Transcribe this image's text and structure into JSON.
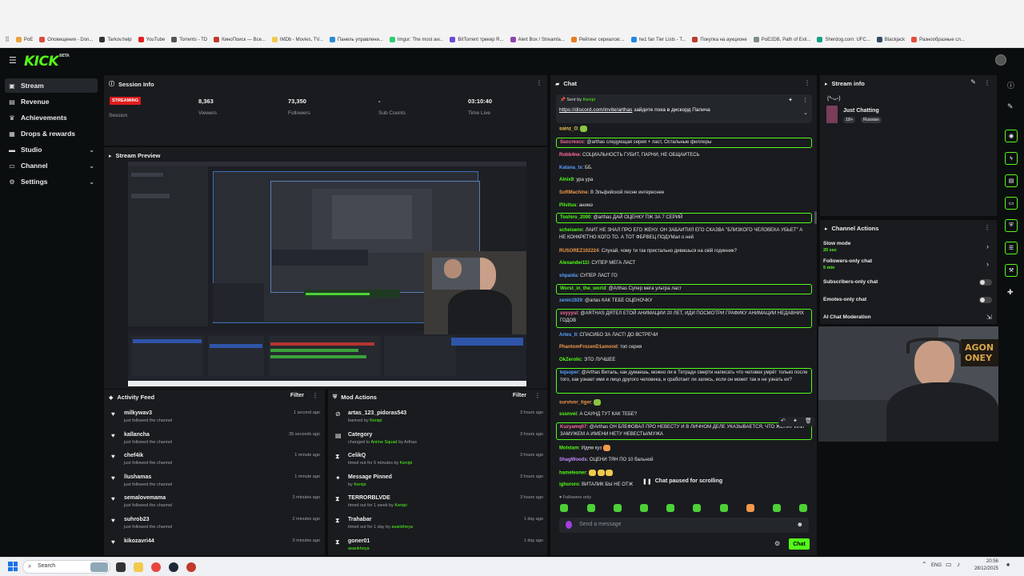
{
  "bookmarks": [
    "PoE",
    "Оповещения - Don...",
    "Tarkov.help",
    "YouTube",
    "Torrents - TD",
    "КиноПоиск — Все...",
    "IMDb - Movies, TV...",
    "Панель управлени...",
    "Imgur: The most aw...",
    "BitTorrent трекер R...",
    "Alert Box / Streamla...",
    "Рейтинг сериалов:...",
    "№1 fan Tier Lists - T...",
    "Покупка на аукционе",
    "PoE2DB, Path of Exil...",
    "Sherdog.com: UFC...",
    "Blackjack",
    "Разнообразные сл..."
  ],
  "header": {
    "logo": "KICK",
    "logo_sup": "BETA"
  },
  "nav": [
    {
      "label": "Stream",
      "icon": "stream-icon"
    },
    {
      "label": "Revenue",
      "icon": "revenue-icon"
    },
    {
      "label": "Achievements",
      "icon": "trophy-icon"
    },
    {
      "label": "Drops & rewards",
      "icon": "gift-icon"
    },
    {
      "label": "Studio",
      "icon": "studio-icon"
    },
    {
      "label": "Channel",
      "icon": "channel-icon"
    },
    {
      "label": "Settings",
      "icon": "gear-icon"
    }
  ],
  "session": {
    "title": "Session Info",
    "status": "STREAMING",
    "session_label": "Session",
    "viewers": "8,363",
    "viewers_label": "Viewers",
    "followers": "73,350",
    "followers_label": "Followers",
    "subs": "-",
    "subs_label": "Sub Counts",
    "time": "03:10:40",
    "time_label": "Time Live"
  },
  "preview": {
    "title": "Stream Preview"
  },
  "activity": {
    "title": "Activity Feed",
    "filter": "Filter",
    "items": [
      {
        "name": "milkywav3",
        "sub": "just followed the channel",
        "time": "1 second ago"
      },
      {
        "name": "kallancha",
        "sub": "just followed the channel",
        "time": "35 seconds ago"
      },
      {
        "name": "chef4ik",
        "sub": "just followed the channel",
        "time": "1 minute ago"
      },
      {
        "name": "llushamas",
        "sub": "just followed the channel",
        "time": "1 minute ago"
      },
      {
        "name": "semalovemama",
        "sub": "just followed the channel",
        "time": "2 minutes ago"
      },
      {
        "name": "suhrob23",
        "sub": "just followed the channel",
        "time": "2 minutes ago"
      },
      {
        "name": "kikozavri44",
        "sub": "",
        "time": "3 minutes ago"
      }
    ]
  },
  "mod": {
    "title": "Mod Actions",
    "filter": "Filter",
    "items": [
      {
        "name": "artas_123_pidoras543",
        "pre": "banned by",
        "by": "Kenipi",
        "post": "",
        "time": "3 hours ago"
      },
      {
        "name": "Category",
        "pre": "changed to",
        "by": "Anime Squad",
        "post": " by Arthas",
        "time": "3 hours ago"
      },
      {
        "name": "CelikQ",
        "pre": "timed out for 5 minutes by",
        "by": "Kenipi",
        "post": "",
        "time": "3 hours ago"
      },
      {
        "name": "Message Pinned",
        "pre": "by",
        "by": "Kenipi",
        "post": "",
        "time": "3 hours ago"
      },
      {
        "name": "TERRORBLVDE",
        "pre": "timed out for 1 week by",
        "by": "Kenipi",
        "post": "",
        "time": "3 hours ago"
      },
      {
        "name": "Trahabar",
        "pre": "timed out for 1 day by",
        "by": "asankheya",
        "post": "",
        "time": "1 day ago"
      },
      {
        "name": "goner01",
        "pre": "",
        "by": "asankheya",
        "post": "",
        "time": "1 day ago"
      }
    ]
  },
  "chat": {
    "title": "Chat",
    "pinned_by_label": "Sent by",
    "pinned_by": "Kenipi",
    "pinned_link": "https://discord.com/invite/arthas",
    "pinned_text": " зайдите пока в дискорд Папича",
    "messages": [
      {
        "u": "sainz_O",
        "c": "#f2c94c",
        "t": ""
      },
      {
        "u": "Succrescc",
        "c": "#ff6b9a",
        "t": "@arthas следующая серия + ласт, Остальные филлеры"
      },
      {
        "u": "Robb4ne",
        "c": "#ff6b9a",
        "t": "СОЦИАЛЬНОСТЬ ГУБИТ, ПАРНИ, НЕ ОБЩАЙТЕСЬ"
      },
      {
        "u": "Katana_tx",
        "c": "#5aa0ff",
        "t": "ББ."
      },
      {
        "u": "Alnix9",
        "c": "#53fc18",
        "t": "ура ура"
      },
      {
        "u": "SoftMachine",
        "c": "#f2994a",
        "t": "В Эльфийской песне интереснее"
      },
      {
        "u": "Pilvitus",
        "c": "#53fc18",
        "t": "анимэ"
      },
      {
        "u": "Toshiro_2000",
        "c": "#53fc18",
        "t": "@arthas ДАЙ ОЦЕНКУ ПЖ ЗА 7 СЕРИЙ"
      },
      {
        "u": "scheisenn",
        "c": "#53fc18",
        "t": "ЛАЙТ НЕ ЗНАЛ ПРО ЕГО ЖЕНУ. ОН ЗАБАЙТИЛ ЕГО СКАЗВА \"БЛИЗКОГО ЧЕЛОВЕКА УБЬЕТ\" А НЕ КОНКРЕТНО КОГО ТО. А ТОТ ФБРВЕЦ ПОДУМал о ней"
      },
      {
        "u": "RUSOREZ102224",
        "c": "#f2994a",
        "t": "Слухай, чому ти так пристально дивишься на свій годинник?"
      },
      {
        "u": "Alexander11l",
        "c": "#53fc18",
        "t": "СУПЕР МЕГА ЛАСТ"
      },
      {
        "u": "shpaida",
        "c": "#5aa0ff",
        "t": "СУПЕР ЛАСТ ГО"
      },
      {
        "u": "Worst_in_the_world",
        "c": "#53fc18",
        "t": "@Arthas Супер мега ультра ласт"
      },
      {
        "u": "zenin1929",
        "c": "#5aa0ff",
        "t": "@artas КАК ТЕБЕ ОЦЕНОЧКУ"
      },
      {
        "u": "svyyyul",
        "c": "#ff6b9a",
        "t": "@ARTHAS ДЯТЕЛ ЕТОЙ АНИМАЦИИ 20 ЛЕТ, ИДИ ПОСМОТРИ ГРАФИКУ АНИМАЦИИ НЕДАВНИХ ГОДОВ"
      },
      {
        "u": "Artes_II",
        "c": "#5aa0ff",
        "t": "СПАСИБО ЗА ЛАСТ! ДО ВСТРЕЧИ"
      },
      {
        "u": "PhantomFrozenD1amond",
        "c": "#f2994a",
        "t": "топ серия"
      },
      {
        "u": "OkZerolic",
        "c": "#53fc18",
        "t": "ЭТО ЛУЧШЕЕ"
      },
      {
        "u": "kqsoper",
        "c": "#5aa0ff",
        "t": "@Arthas Виталь, как думаешь, можно ли в Тетради смерти написать что человек умрёт только после того, как узнает имя и лицо другого человека, и сработает ли запись, если он может так и не узнать их?"
      },
      {
        "u": "survivor_tiger",
        "c": "#f2994a",
        "t": ""
      },
      {
        "u": "sssnvel",
        "c": "#53fc18",
        "t": "А САУНД ТУТ КАК ТЕБЕ?"
      },
      {
        "u": "Kuzyamq07",
        "c": "#ff6b9a",
        "t": "@Arthas ОН БЛЕФОВАЛ ПРО НЕВЕСТУ И В ЛИЧНОМ ДЕЛЕ УКАЗЫВАЕТСЯ, ЧТО ЖЕНАТ ИЛИ ЗАМУЖЕМ А ИМЕНИ НЕТУ НЕВЕСТЫ/МУЖА"
      },
      {
        "u": "Molstam",
        "c": "#53fc18",
        "t": "Идем куз"
      },
      {
        "u": "ShagWoods",
        "c": "#c58aff",
        "t": "ОЦЕНИ ТЯН ПО 10 бальной"
      },
      {
        "u": "hameleoner",
        "c": "#53fc18",
        "t": ""
      },
      {
        "u": "ighororo",
        "c": "#53fc18",
        "t": "ВИТАЛИК БЫ НЕ ОТЖ"
      }
    ],
    "paused": "Chat paused for scrolling",
    "followers_only": "Followers only",
    "placeholder": "Send a message",
    "send": "Chat"
  },
  "stream_info": {
    "title": "Stream info",
    "stream_title": "(*ᵕᴗᵕ)",
    "category": "Just Chatting",
    "tags": [
      "18+",
      "Russian"
    ]
  },
  "channel_actions": {
    "title": "Channel Actions",
    "items": [
      {
        "label": "Slow mode",
        "sub": "20 sec"
      },
      {
        "label": "Followers-only chat",
        "sub": "5 min"
      },
      {
        "label": "Subscribers-only chat",
        "sub": ""
      },
      {
        "label": "Emotes-only chat",
        "sub": ""
      },
      {
        "label": "AI Chat Moderation",
        "sub": ""
      }
    ]
  },
  "taskbar": {
    "search": "Search",
    "lang": "ENG",
    "time": "20:56",
    "date": "28/12/2025"
  },
  "colors": {
    "accent": "#53fc18",
    "panel": "#191b1f",
    "bg": "#0b0d0e",
    "live": "#e01b1b"
  }
}
